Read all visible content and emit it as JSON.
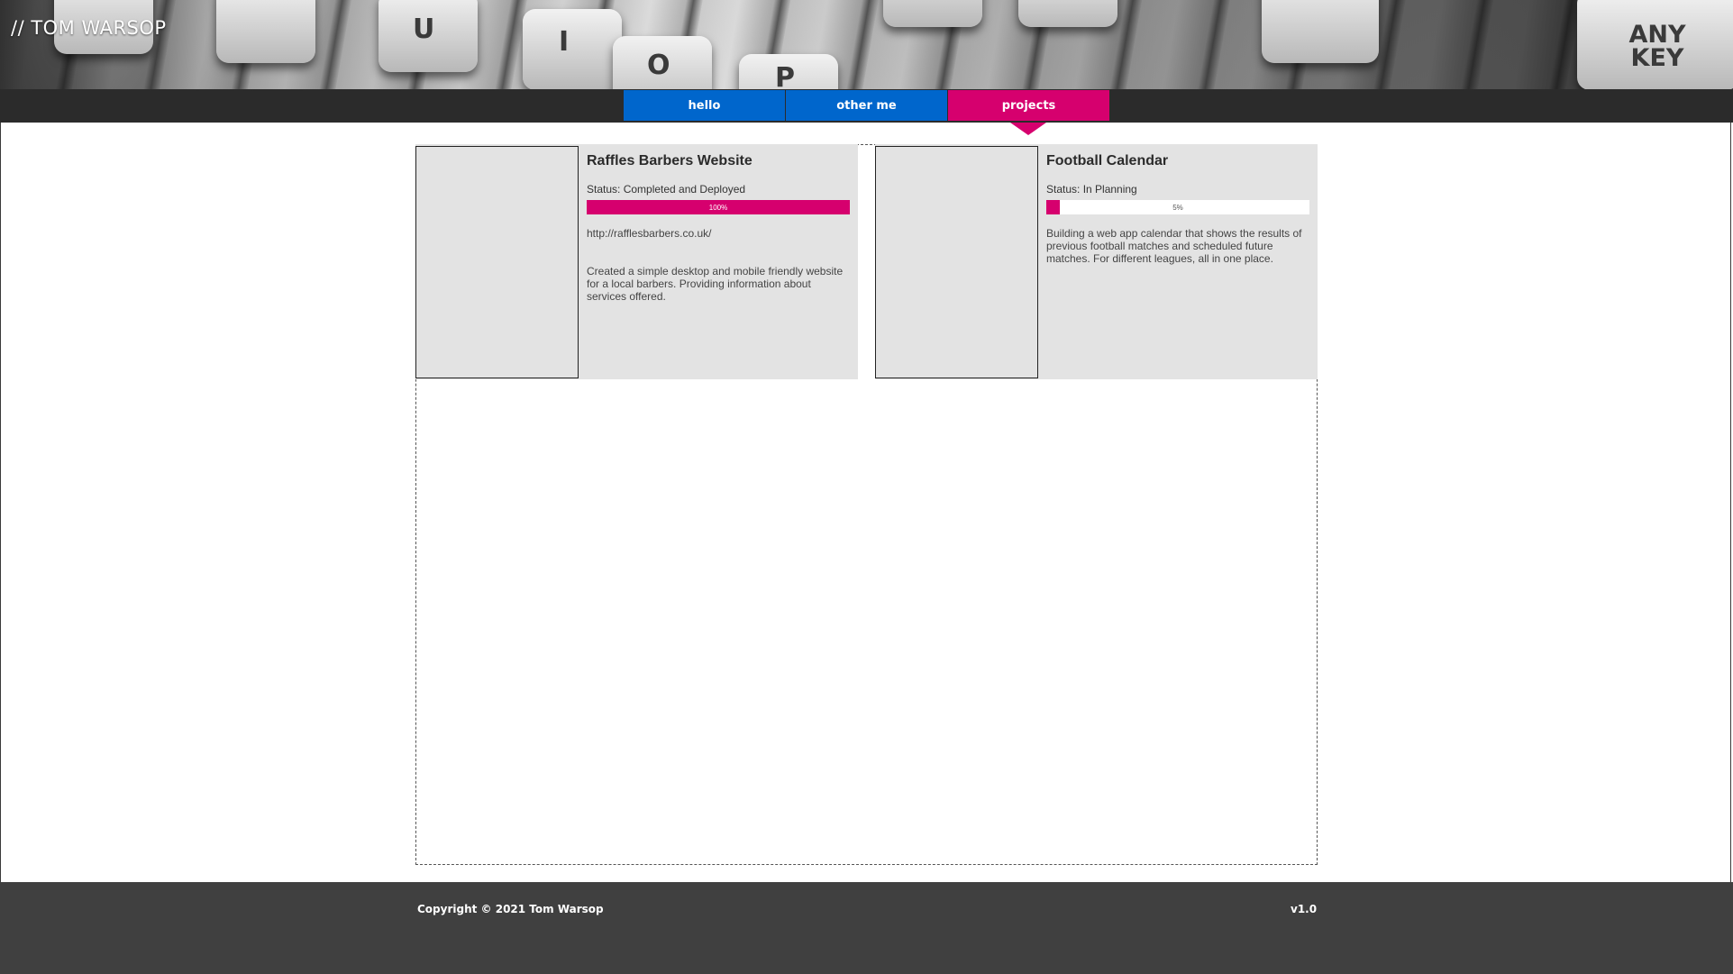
{
  "header": {
    "title": "// TOM WARSOP",
    "banner_keys": [
      "U",
      "I",
      "O",
      "P",
      "ANY KEY"
    ]
  },
  "nav": {
    "tabs": [
      {
        "label": "hello",
        "active": false
      },
      {
        "label": "other me",
        "active": false
      },
      {
        "label": "projects",
        "active": true
      }
    ]
  },
  "projects": [
    {
      "title": "Raffles Barbers Website",
      "status": "Status: Completed and Deployed",
      "progress": 100,
      "progress_label": "100%",
      "link": "http://rafflesbarbers.co.uk/",
      "description": "Created a simple desktop and mobile friendly website for a local barbers. Providing information about services offered."
    },
    {
      "title": "Football Calendar",
      "status": "Status: In Planning",
      "progress": 5,
      "progress_label": "5%",
      "link": "",
      "description": "Building a web app calendar that shows the results of previous football matches and scheduled future matches. For different leagues, all in one place."
    }
  ],
  "footer": {
    "copyright": "Copyright © 2021 Tom Warsop",
    "version": "v1.0"
  },
  "colors": {
    "nav_blue": "#0066cc",
    "accent_pink": "#d6006e",
    "nav_bar": "#2b2b2b",
    "footer": "#404040",
    "card_bg": "#e3e3e3"
  }
}
